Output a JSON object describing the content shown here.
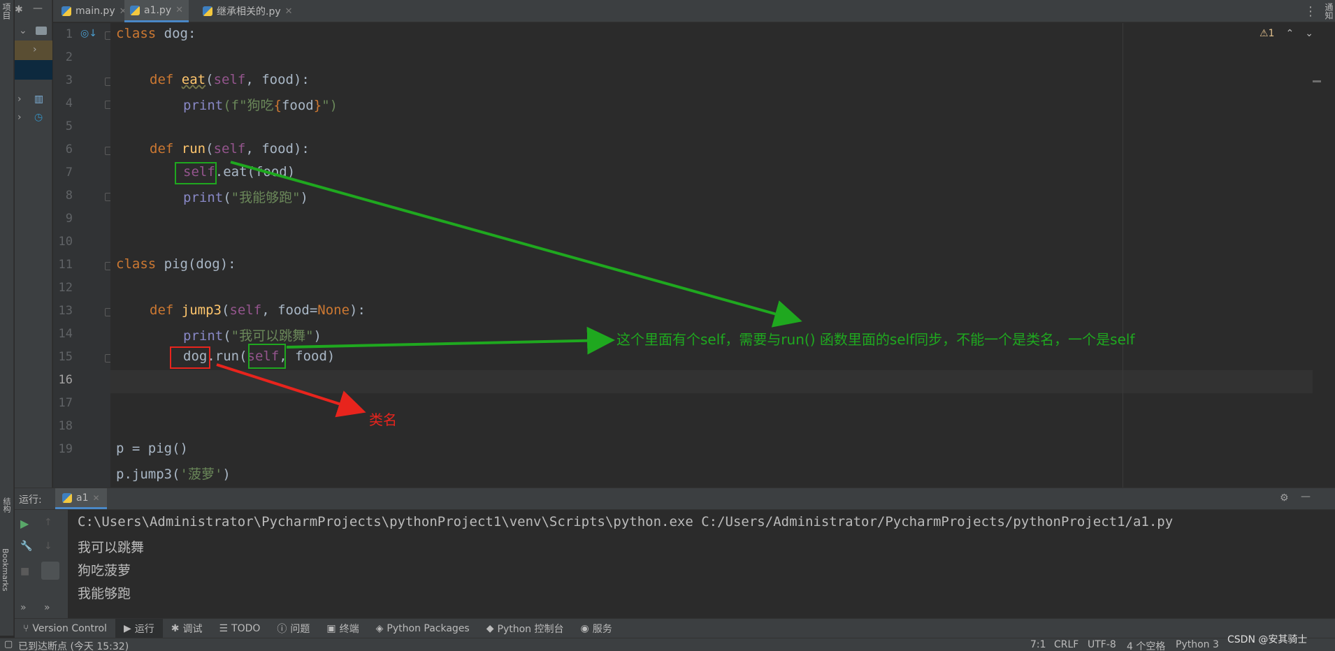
{
  "left_strip": {
    "project_label": "项目",
    "structure_label": "结构",
    "bookmarks_label": "Bookmarks"
  },
  "right_strip": {
    "notifications_label": "通知"
  },
  "tabs": [
    {
      "label": "main.py",
      "active": false
    },
    {
      "label": "a1.py",
      "active": true
    },
    {
      "label": "继承相关的.py",
      "active": false
    }
  ],
  "inspection": {
    "warnings": "⚠1"
  },
  "code_lines": [
    {
      "n": "1"
    },
    {
      "n": "2"
    },
    {
      "n": "3"
    },
    {
      "n": "4"
    },
    {
      "n": "5"
    },
    {
      "n": "6"
    },
    {
      "n": "7"
    },
    {
      "n": "8"
    },
    {
      "n": "9"
    },
    {
      "n": "10"
    },
    {
      "n": "11"
    },
    {
      "n": "12"
    },
    {
      "n": "13"
    },
    {
      "n": "14"
    },
    {
      "n": "15"
    },
    {
      "n": "16"
    },
    {
      "n": "17"
    },
    {
      "n": "18"
    },
    {
      "n": "19"
    }
  ],
  "code": {
    "l1": [
      "class",
      " dog:"
    ],
    "l3": [
      "def",
      "eat",
      "(",
      "self",
      ", food):"
    ],
    "l4": [
      "print",
      "(f\"狗吃",
      "{",
      "food",
      "}",
      "\")"
    ],
    "l6": [
      "def",
      "run",
      "(",
      "self",
      ", food):"
    ],
    "l7": [
      "self",
      ".eat(food)"
    ],
    "l8": [
      "print",
      "(",
      "\"我能够跑\"",
      ")"
    ],
    "l11": [
      "class",
      " pig(dog):"
    ],
    "l13": [
      "def",
      "jump3",
      "(",
      "self",
      ", food=",
      "None",
      "):"
    ],
    "l14": [
      "print",
      "(",
      "\"我可以跳舞\"",
      ")"
    ],
    "l15": [
      "dog.run(",
      "self",
      ", food)"
    ],
    "l18": "p = pig()",
    "l19": [
      "p.jump3(",
      "'菠萝'",
      ")"
    ]
  },
  "annotations": {
    "note_main": "这个里面有个self，需要与run()  函数里面的self同步，不能一个是类名，一个是self",
    "note_class": "类名",
    "color_green": "#1fa81f",
    "color_red": "#e8241d"
  },
  "run_panel": {
    "label": "运行:",
    "tab": "a1",
    "output": [
      "C:\\Users\\Administrator\\PycharmProjects\\pythonProject1\\venv\\Scripts\\python.exe C:/Users/Administrator/PycharmProjects/pythonProject1/a1.py",
      "我可以跳舞",
      "狗吃菠萝",
      "我能够跑"
    ]
  },
  "tool_windows": [
    {
      "label": "Version Control",
      "icon": "branch-icon"
    },
    {
      "label": "运行",
      "icon": "play-icon",
      "active": true
    },
    {
      "label": "调试",
      "icon": "bug-icon"
    },
    {
      "label": "TODO",
      "icon": "list-icon"
    },
    {
      "label": "问题",
      "icon": "info-icon"
    },
    {
      "label": "终端",
      "icon": "terminal-icon"
    },
    {
      "label": "Python Packages",
      "icon": "package-icon"
    },
    {
      "label": "Python 控制台",
      "icon": "python-icon"
    },
    {
      "label": "服务",
      "icon": "services-icon"
    }
  ],
  "status": {
    "message": "已到达断点 (今天 15:32)",
    "position": "7:1",
    "line_sep": "CRLF",
    "encoding": "UTF-8",
    "indent": "4 个空格",
    "interpreter": "Python 3",
    "watermark": "CSDN @安其骑士"
  }
}
